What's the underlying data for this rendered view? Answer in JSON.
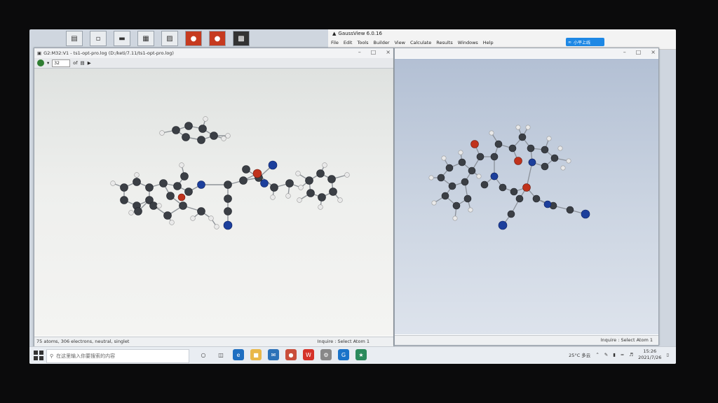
{
  "desktop": {
    "icons": [
      "pdf-icon",
      "doc-icon",
      "file-icon",
      "shortcut-icon",
      "image-icon",
      "app-icon",
      "app-red-icon",
      "app-red2-icon",
      "qr-icon"
    ]
  },
  "gaussview": {
    "title": "GaussView 6.0.16",
    "menu": [
      "File",
      "Edit",
      "Tools",
      "Builder",
      "View",
      "Calculate",
      "Results",
      "Windows",
      "Help"
    ],
    "badge": "小平上线"
  },
  "left_window": {
    "title": "G2:M32:V1 - ts1-opt-pro.log (D:/keti/7.11/ts1-opt-pro.log)",
    "spin_value": "32",
    "of_label": "of",
    "status_left": "75 atoms, 306 electrons, neutral, singlet",
    "status_right": "Inquire : Select Atom 1"
  },
  "right_window": {
    "status_right": "Inquire : Select Atom 1"
  },
  "taskbar": {
    "search_placeholder": "在这里输入你要搜索的内容",
    "weather": "25°C 多云",
    "time": "15:26",
    "date": "2021/7/26"
  },
  "colors": {
    "carbon": "#3b3f45",
    "hydrogen": "#e8e8e8",
    "oxygen": "#c0321c",
    "nitrogen": "#1c3f9c",
    "accent": "#1e88e5"
  }
}
